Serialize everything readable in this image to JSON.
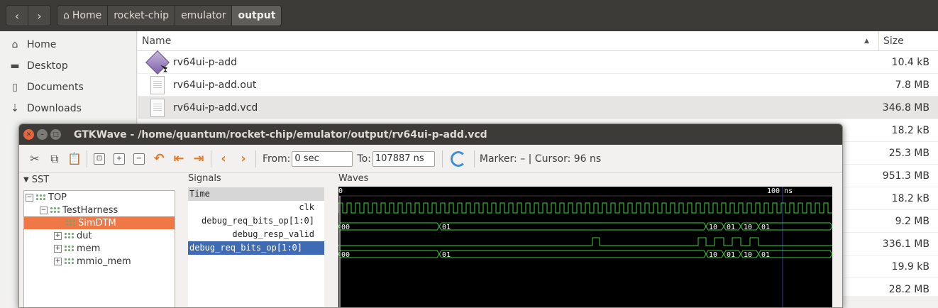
{
  "filemanager": {
    "breadcrumbs": [
      "Home",
      "rocket-chip",
      "emulator",
      "output"
    ],
    "sidebar": [
      {
        "label": "Home",
        "icon": "home-icon"
      },
      {
        "label": "Desktop",
        "icon": "desktop-folder-icon"
      },
      {
        "label": "Documents",
        "icon": "documents-icon"
      },
      {
        "label": "Downloads",
        "icon": "downloads-icon"
      }
    ],
    "columns": {
      "name": "Name",
      "size": "Size"
    },
    "files": [
      {
        "name": "rv64ui-p-add",
        "size": "10.4 kB",
        "icon": "executable-icon"
      },
      {
        "name": "rv64ui-p-add.out",
        "size": "7.8 MB",
        "icon": "text-file-icon"
      },
      {
        "name": "rv64ui-p-add.vcd",
        "size": "346.8 MB",
        "icon": "text-file-icon"
      }
    ],
    "hidden_sizes": [
      "18.2 kB",
      "25.3 MB",
      "951.3 MB",
      "18.2 kB",
      "9.2 MB",
      "336.1 MB",
      "19.9 kB",
      "28.2 MB"
    ]
  },
  "gtkwave": {
    "title": "GTKWave - /home/quantum/rocket-chip/emulator/output/rv64ui-p-add.vcd",
    "from_label": "From:",
    "from_value": "0 sec",
    "to_label": "To:",
    "to_value": "107887 ns",
    "marker_text": "Marker: – | Cursor: 96 ns",
    "sst": {
      "header": "SST",
      "tree": [
        {
          "label": "TOP",
          "level": 0,
          "expander": "−"
        },
        {
          "label": "TestHarness",
          "level": 1,
          "expander": "−"
        },
        {
          "label": "SimDTM",
          "level": 2,
          "expander": "",
          "selected": true
        },
        {
          "label": "dut",
          "level": 2,
          "expander": "+"
        },
        {
          "label": "mem",
          "level": 2,
          "expander": "+"
        },
        {
          "label": "mmio_mem",
          "level": 2,
          "expander": "+"
        }
      ]
    },
    "signals": {
      "header": "Signals",
      "rows": [
        {
          "label": "Time",
          "kind": "time"
        },
        {
          "label": "clk",
          "kind": "normal"
        },
        {
          "label": "debug_req_bits_op[1:0]",
          "kind": "normal"
        },
        {
          "label": "debug_resp_valid",
          "kind": "normal"
        },
        {
          "label": "debug_req_bits_op[1:0]",
          "kind": "selected"
        }
      ]
    },
    "waves": {
      "header": "Waves",
      "time_start_label": "0",
      "time_marker_label": "100 ns",
      "bus1": [
        "00",
        "01",
        "10",
        "01",
        "10",
        "01"
      ],
      "bus2": [
        "00",
        "01",
        "10",
        "01",
        "10",
        "01"
      ],
      "trace_color": "#39d239",
      "cursor_color": "#6f6fd6"
    }
  }
}
